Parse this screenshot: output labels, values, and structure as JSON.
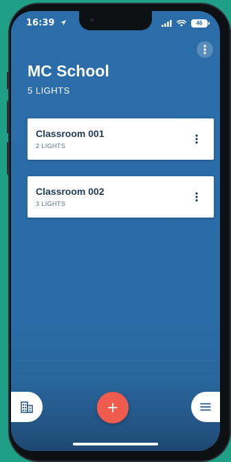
{
  "status_bar": {
    "time": "16:39",
    "battery": "46"
  },
  "header": {
    "title": "MC School",
    "subtitle": "5 LIGHTS"
  },
  "rooms": [
    {
      "name": "Classroom 001",
      "count": "2 LIGHTS"
    },
    {
      "name": "Classroom 002",
      "count": "3 LIGHTS"
    }
  ],
  "icons": {
    "location": "location-arrow-icon",
    "signal": "cellular-signal-icon",
    "wifi": "wifi-icon",
    "battery": "battery-icon",
    "top_menu": "more-vertical-icon",
    "room_menu": "more-vertical-icon",
    "buildings": "buildings-icon",
    "add": "plus-icon",
    "menu": "hamburger-menu-icon"
  },
  "colors": {
    "background": "#1f9f86",
    "screen": "#2a6da8",
    "card_title": "#1f3b57",
    "fab": "#ef5b4d",
    "icon": "#2a5a8c"
  }
}
